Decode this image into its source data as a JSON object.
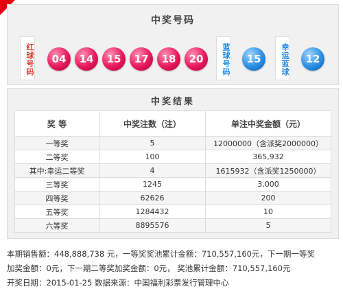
{
  "numbers": {
    "title": "中奖号码",
    "red_label": "红球号码",
    "red_balls": [
      "04",
      "14",
      "15",
      "17",
      "18",
      "20"
    ],
    "blue_label": "蓝球号码",
    "blue_ball": "15",
    "lucky_label": "幸运蓝球",
    "lucky_ball": "12"
  },
  "results": {
    "title": "中奖结果",
    "headers": [
      "奖 等",
      "中奖注数（注）",
      "单注中奖金额（元）"
    ],
    "rows": [
      {
        "level": "一等奖",
        "count": "5",
        "amount": "12000000（含派奖2000000）"
      },
      {
        "level": "二等奖",
        "count": "100",
        "amount": "365,932"
      },
      {
        "level": "其中:幸运二等奖",
        "count": "4",
        "amount": "1615932（含派奖1250000）"
      },
      {
        "level": "三等奖",
        "count": "1245",
        "amount": "3,000"
      },
      {
        "level": "四等奖",
        "count": "62626",
        "amount": "200"
      },
      {
        "level": "五等奖",
        "count": "1284432",
        "amount": "10"
      },
      {
        "level": "六等奖",
        "count": "8895576",
        "amount": "5"
      }
    ]
  },
  "info": {
    "line1": "本期销售额：448,888,738 元，一等奖奖池累计金额：710,557,160元，下一期一等奖",
    "line2": "加奖金额：0元，下一期二等奖加奖金额：0元， 奖池累计金额：710,557,160元",
    "line3": "开奖日期：2015-01-25 数据来源：中国福利彩票发行管理中心"
  },
  "colors": {
    "red_ball": "#e8195a",
    "blue_ball": "#2a8fe3",
    "corner": "#e60012"
  }
}
